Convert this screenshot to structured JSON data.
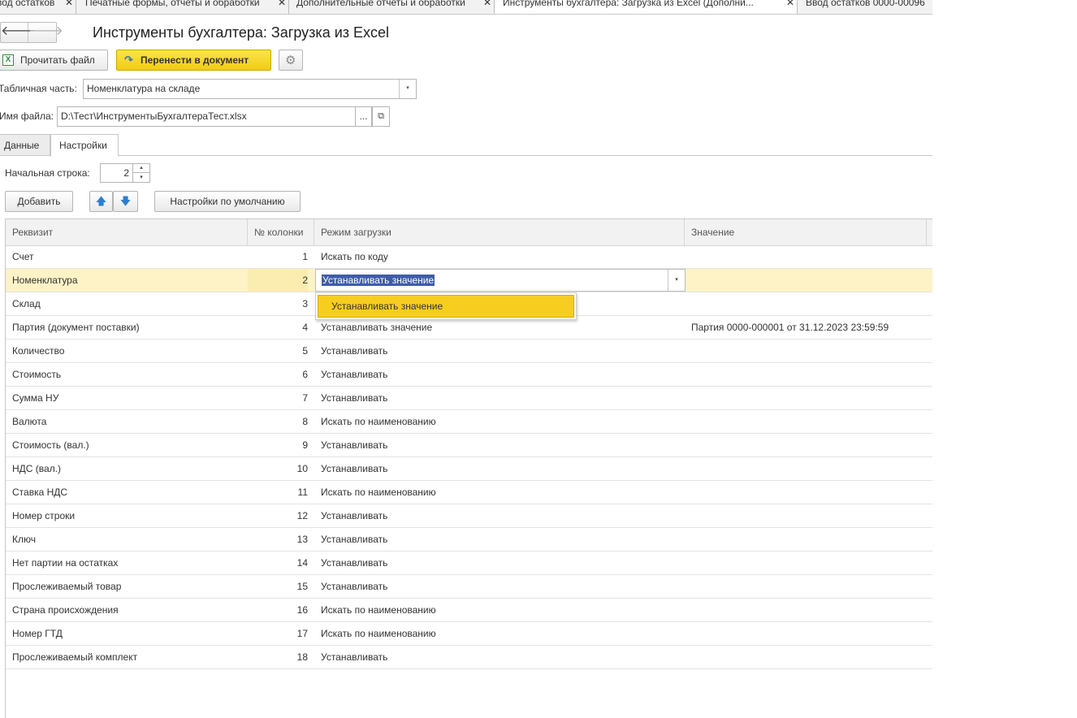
{
  "window_tabs": [
    {
      "label": "вод остатков",
      "active": false
    },
    {
      "label": "Печатные формы, отчеты и обработки",
      "active": false
    },
    {
      "label": "Дополнительные отчеты и обработки",
      "active": false
    },
    {
      "label": "Инструменты бухгалтера: Загрузка из Excel (Дополни...",
      "active": true
    },
    {
      "label": "Ввод остатков 0000-00096",
      "active": false
    }
  ],
  "close_glyph": "✕",
  "nav": {
    "back": "🡐",
    "forward": "🡒"
  },
  "title": "Инструменты бухгалтера: Загрузка из Excel",
  "toolbar": {
    "read_file": "Прочитать файл",
    "transfer": "Перенести в документ",
    "xls_icon": "X",
    "transfer_icon": "↷",
    "settings_icon": "⚙"
  },
  "table_part": {
    "label": "Табличная часть:",
    "value": "Номенклатура на складе"
  },
  "file": {
    "label": "Имя файла:",
    "value": "D:\\Тест\\ИнструментыБухгалтераТест.xlsx",
    "select_button": "...",
    "open_button": "⧉"
  },
  "form_tabs": [
    {
      "label": "Данные",
      "active": false
    },
    {
      "label": "Настройки",
      "active": true
    }
  ],
  "start_row": {
    "label": "Начальная строка:",
    "value": "2"
  },
  "actions": {
    "add": "Добавить",
    "up_icon": "🡅",
    "down_icon": "🡇",
    "defaults": "Настройки по умолчанию"
  },
  "table": {
    "columns": [
      "Реквизит",
      "№ колонки",
      "Режим загрузки",
      "Значение"
    ],
    "rows": [
      {
        "attr": "Счет",
        "col": "1",
        "mode": "Искать по коду",
        "value": ""
      },
      {
        "attr": "Номенклатура",
        "col": "2",
        "mode": "Устанавливать значение",
        "value": ""
      },
      {
        "attr": "Склад",
        "col": "3",
        "mode": "",
        "value": ""
      },
      {
        "attr": "Партия (документ поставки)",
        "col": "4",
        "mode": "Устанавливать значение",
        "value": "Партия 0000-000001 от 31.12.2023 23:59:59"
      },
      {
        "attr": "Количество",
        "col": "5",
        "mode": "Устанавливать",
        "value": ""
      },
      {
        "attr": "Стоимость",
        "col": "6",
        "mode": "Устанавливать",
        "value": ""
      },
      {
        "attr": "Сумма НУ",
        "col": "7",
        "mode": "Устанавливать",
        "value": ""
      },
      {
        "attr": "Валюта",
        "col": "8",
        "mode": "Искать по наименованию",
        "value": ""
      },
      {
        "attr": "Стоимость (вал.)",
        "col": "9",
        "mode": "Устанавливать",
        "value": ""
      },
      {
        "attr": "НДС (вал.)",
        "col": "10",
        "mode": "Устанавливать",
        "value": ""
      },
      {
        "attr": "Ставка НДС",
        "col": "11",
        "mode": "Искать по наименованию",
        "value": ""
      },
      {
        "attr": "Номер строки",
        "col": "12",
        "mode": "Устанавливать",
        "value": ""
      },
      {
        "attr": "Ключ",
        "col": "13",
        "mode": "Устанавливать",
        "value": ""
      },
      {
        "attr": "Нет партии на остатках",
        "col": "14",
        "mode": "Устанавливать",
        "value": ""
      },
      {
        "attr": "Прослеживаемый товар",
        "col": "15",
        "mode": "Устанавливать",
        "value": ""
      },
      {
        "attr": "Страна происхождения",
        "col": "16",
        "mode": "Искать по наименованию",
        "value": ""
      },
      {
        "attr": "Номер ГТД",
        "col": "17",
        "mode": "Искать по наименованию",
        "value": ""
      },
      {
        "attr": "Прослеживаемый комплект",
        "col": "18",
        "mode": "Устанавливать",
        "value": ""
      }
    ],
    "selected_row": 1
  },
  "dropdown": {
    "option": "Устанавливать значение"
  },
  "dropdown_glyph": "▾",
  "spin_up": "▴",
  "spin_down": "▾",
  "colors": {
    "accent_yellow": "#f0cc14",
    "selected_row": "#fdf3c6",
    "selection_text_bg": "#3f5ca8"
  }
}
